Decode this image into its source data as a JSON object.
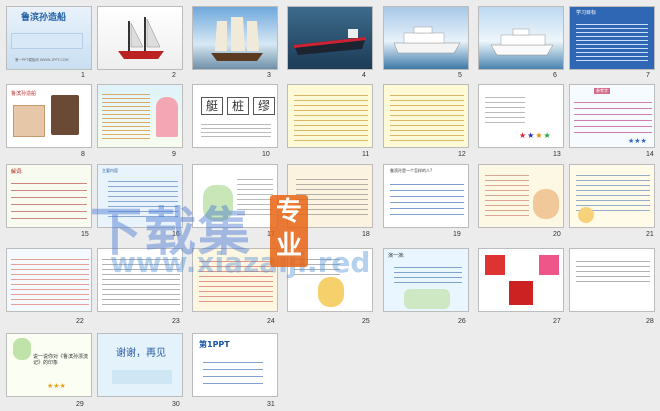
{
  "slides": [
    {
      "n": "1",
      "title": "鲁滨孙造船",
      "sub": "第一PPT模板网 WWW.1PPT.COM"
    },
    {
      "n": "2"
    },
    {
      "n": "3"
    },
    {
      "n": "4"
    },
    {
      "n": "5"
    },
    {
      "n": "6"
    },
    {
      "n": "7",
      "title": "学习目标"
    },
    {
      "n": "8",
      "title": "鲁滨孙造船"
    },
    {
      "n": "9"
    },
    {
      "n": "10",
      "words": [
        "艇",
        "桩",
        "缪"
      ]
    },
    {
      "n": "11"
    },
    {
      "n": "12"
    },
    {
      "n": "13"
    },
    {
      "n": "14",
      "title": "参考字"
    },
    {
      "n": "15",
      "title": "解词:"
    },
    {
      "n": "16",
      "title": "主要内容"
    },
    {
      "n": "17"
    },
    {
      "n": "18"
    },
    {
      "n": "19",
      "title": "鲁滨孙是一个怎样的人?"
    },
    {
      "n": "20"
    },
    {
      "n": "21"
    },
    {
      "n": "22"
    },
    {
      "n": "23"
    },
    {
      "n": "24"
    },
    {
      "n": "25"
    },
    {
      "n": "26",
      "title": "演一演:"
    },
    {
      "n": "27"
    },
    {
      "n": "28"
    },
    {
      "n": "29",
      "title": "说一说你对《鲁滨孙漂流记》的印象"
    },
    {
      "n": "30",
      "title": "谢谢，再见"
    },
    {
      "n": "31",
      "title": "第1PPT"
    }
  ],
  "watermark": {
    "main": "下载集",
    "url": "www.xiazaiji.red",
    "badge": "专业"
  }
}
